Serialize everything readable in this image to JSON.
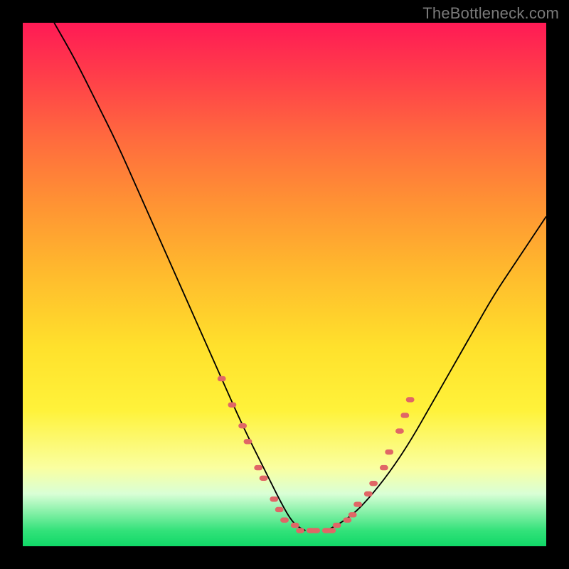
{
  "watermark": "TheBottleneck.com",
  "colors": {
    "frame": "#000000",
    "curve": "#000000",
    "marker": "#e06666",
    "gradient_stops": [
      "#ff1a55",
      "#ff3d4a",
      "#ff6a3e",
      "#ff9433",
      "#ffbb2d",
      "#ffe12c",
      "#fff23a",
      "#faffa0",
      "#d9ffd6",
      "#33e27a",
      "#10d867"
    ]
  },
  "chart_data": {
    "type": "line",
    "title": "",
    "xlabel": "",
    "ylabel": "",
    "xlim": [
      0,
      100
    ],
    "ylim": [
      0,
      100
    ],
    "grid": false,
    "legend": false,
    "note": "Values read visually; x is normalized position, y is normalized height (0 bottom, 100 top).",
    "series": [
      {
        "name": "left-curve",
        "x": [
          6,
          10,
          14,
          18,
          22,
          26,
          30,
          34,
          38,
          42,
          46,
          50,
          52,
          54
        ],
        "values": [
          100,
          93,
          85,
          77,
          68,
          59,
          50,
          41,
          32,
          23,
          15,
          7,
          4,
          3
        ]
      },
      {
        "name": "right-curve",
        "x": [
          58,
          60,
          63,
          66,
          70,
          74,
          78,
          82,
          86,
          90,
          94,
          98,
          100
        ],
        "values": [
          3,
          4,
          6,
          9,
          14,
          20,
          27,
          34,
          41,
          48,
          54,
          60,
          63
        ]
      }
    ],
    "markers": {
      "name": "dotted-highlight",
      "points": [
        {
          "x": 38,
          "y": 32
        },
        {
          "x": 40,
          "y": 27
        },
        {
          "x": 42,
          "y": 23
        },
        {
          "x": 43,
          "y": 20
        },
        {
          "x": 45,
          "y": 15
        },
        {
          "x": 46,
          "y": 13
        },
        {
          "x": 48,
          "y": 9
        },
        {
          "x": 49,
          "y": 7
        },
        {
          "x": 50,
          "y": 5
        },
        {
          "x": 52,
          "y": 4
        },
        {
          "x": 53,
          "y": 3
        },
        {
          "x": 55,
          "y": 3
        },
        {
          "x": 56,
          "y": 3
        },
        {
          "x": 58,
          "y": 3
        },
        {
          "x": 59,
          "y": 3
        },
        {
          "x": 60,
          "y": 4
        },
        {
          "x": 62,
          "y": 5
        },
        {
          "x": 63,
          "y": 6
        },
        {
          "x": 64,
          "y": 8
        },
        {
          "x": 66,
          "y": 10
        },
        {
          "x": 67,
          "y": 12
        },
        {
          "x": 69,
          "y": 15
        },
        {
          "x": 70,
          "y": 18
        },
        {
          "x": 72,
          "y": 22
        },
        {
          "x": 73,
          "y": 25
        },
        {
          "x": 74,
          "y": 28
        }
      ]
    }
  }
}
